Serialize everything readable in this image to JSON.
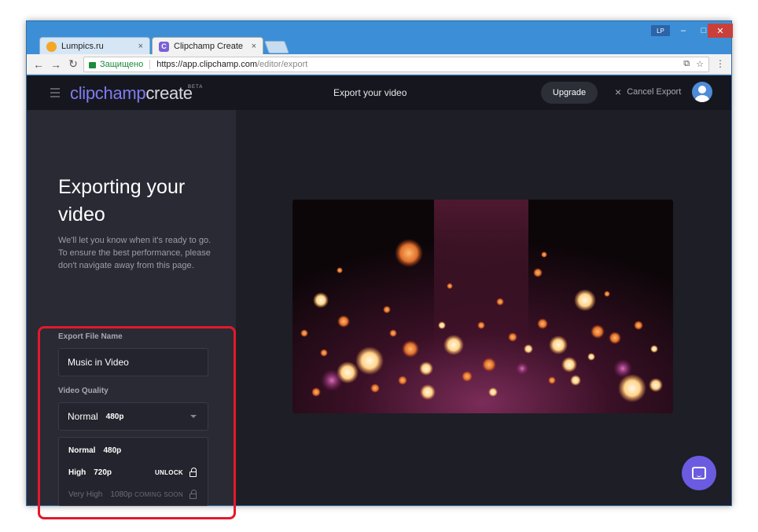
{
  "browser": {
    "tabs": [
      {
        "label": "Lumpics.ru",
        "close": "×"
      },
      {
        "label": "Clipchamp Create",
        "close": "×"
      }
    ],
    "user_badge": "LP",
    "window_controls": {
      "minimize": "–",
      "maximize": "□",
      "close": "✕"
    },
    "nav": {
      "back": "←",
      "forward": "→",
      "reload": "↻"
    },
    "secure_label": "Защищено",
    "url_host": "https://app.clipchamp.com",
    "url_path": "/editor/export",
    "menu": "⋮"
  },
  "app": {
    "brand_clip": "clipchamp",
    "brand_create": "create",
    "brand_badge": "BETA",
    "title": "Export your video",
    "upgrade_label": "Upgrade",
    "cancel_label": "Cancel Export",
    "cancel_icon": "×"
  },
  "sidebar": {
    "heading": "Exporting your video",
    "desc_line1": "We'll let you know when it's ready to go.",
    "desc_line2": "To ensure the best performance, please don't navigate away from this page.",
    "file_name_label": "Export File Name",
    "file_name_value": "Music in Video",
    "quality_label": "Video Quality",
    "quality_selected": {
      "name": "Normal",
      "res": "480p"
    },
    "options": [
      {
        "name": "Normal",
        "res": "480p",
        "action": ""
      },
      {
        "name": "High",
        "res": "720p",
        "action": "UNLOCK"
      },
      {
        "name": "Very High",
        "res": "1080p",
        "action": "COMING SOON"
      }
    ]
  },
  "colors": {
    "accent": "#7f7bf0",
    "highlight": "#e3192a",
    "chat": "#6b5be0",
    "sidebar_bg": "#292a34",
    "app_bg": "#1d1e26"
  }
}
